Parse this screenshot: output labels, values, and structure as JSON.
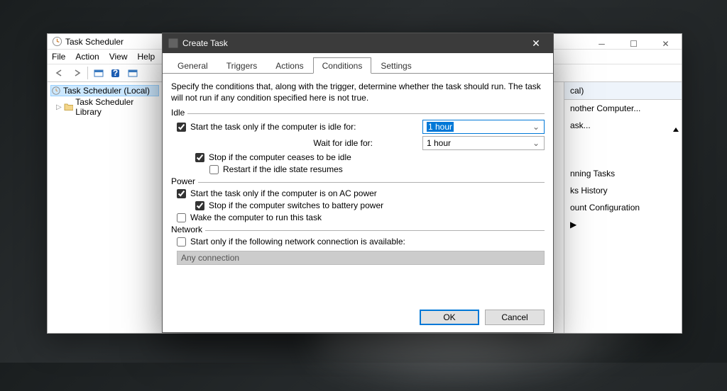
{
  "back_window": {
    "title": "Task Scheduler",
    "menu": [
      "File",
      "Action",
      "View",
      "Help"
    ],
    "tree": {
      "root": "Task Scheduler (Local)",
      "child": "Task Scheduler Library"
    },
    "actions": {
      "item0_suffix": "cal)",
      "item1_suffix": "nother Computer...",
      "item2_suffix": "ask...",
      "item3_suffix": "nning Tasks",
      "item4_suffix": "ks History",
      "item5_suffix": "ount Configuration"
    }
  },
  "dialog": {
    "title": "Create Task",
    "tabs": [
      "General",
      "Triggers",
      "Actions",
      "Conditions",
      "Settings"
    ],
    "active_tab": "Conditions",
    "description": "Specify the conditions that, along with the trigger, determine whether the task should run.  The task will not run  if any condition specified here is not true.",
    "sections": {
      "idle": {
        "label": "Idle",
        "start_only_idle": "Start the task only if the computer is idle for:",
        "idle_for_value": "1 hour",
        "wait_label": "Wait for idle for:",
        "wait_value": "1 hour",
        "stop_ceases": "Stop if the computer ceases to be idle",
        "restart_resumes": "Restart if the idle state resumes"
      },
      "power": {
        "label": "Power",
        "on_ac": "Start the task only if the computer is on AC power",
        "stop_battery": "Stop if the computer switches to battery power",
        "wake": "Wake the computer to run this task"
      },
      "network": {
        "label": "Network",
        "start_only": "Start only if the following network connection is available:",
        "value": "Any connection"
      }
    },
    "buttons": {
      "ok": "OK",
      "cancel": "Cancel"
    }
  }
}
